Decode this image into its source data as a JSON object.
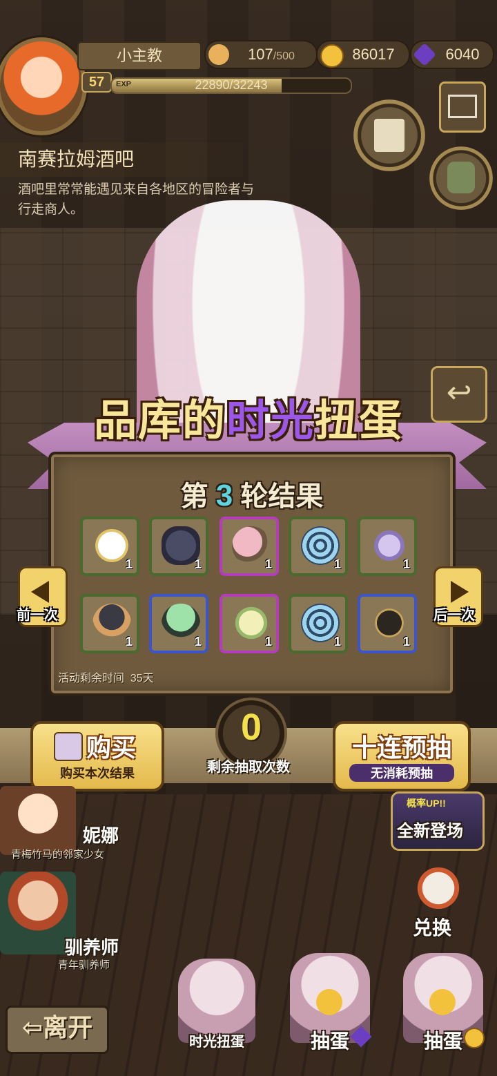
{
  "colors": {
    "panel_bg": "#6f5a3d",
    "title_gold": "#f8e79a",
    "title_purple": "#9b57e8",
    "round_number": "#5fd3e0",
    "count_yellow": "#f4e04a"
  },
  "player": {
    "name": "小主教",
    "level": "57",
    "exp_tag": "EXP",
    "exp_text": "22890/32243",
    "exp_fraction": 0.71
  },
  "resources": [
    {
      "icon": "bread-icon",
      "value": "107",
      "max": "/500"
    },
    {
      "icon": "gold-coin-icon",
      "value": "86017"
    },
    {
      "icon": "purple-gem-icon",
      "value": "6040"
    }
  ],
  "location": {
    "name": "南赛拉姆酒吧",
    "description": "酒吧里常常能遇见来自各地区的冒险者与行走商人。"
  },
  "banner": {
    "title_prefix": "品库的",
    "title_highlight": "时光",
    "title_suffix": "扭蛋"
  },
  "result": {
    "prefix": "第",
    "round": "3",
    "suffix": "轮结果",
    "timer_label": "活动剩余时间",
    "timer_value": "35天",
    "items": [
      {
        "name": "cloud-planet-icon",
        "qty": "1",
        "rarity": "green"
      },
      {
        "name": "dark-shell-icon",
        "qty": "1",
        "rarity": "green"
      },
      {
        "name": "pink-creature-icon",
        "qty": "1",
        "rarity": "purple"
      },
      {
        "name": "blue-spiral-shell-icon",
        "qty": "1",
        "rarity": "green"
      },
      {
        "name": "purple-seashell-icon",
        "qty": "1",
        "rarity": "green"
      },
      {
        "name": "dark-egg-icon",
        "qty": "1",
        "rarity": "green"
      },
      {
        "name": "green-slime-icon",
        "qty": "1",
        "rarity": "blue"
      },
      {
        "name": "leaf-snail-icon",
        "qty": "1",
        "rarity": "purple"
      },
      {
        "name": "blue-spiral-shell-icon",
        "qty": "1",
        "rarity": "green"
      },
      {
        "name": "dark-moth-icon",
        "qty": "1",
        "rarity": "blue"
      }
    ]
  },
  "nav": {
    "prev": "前一次",
    "next": "后一次"
  },
  "actions": {
    "buy_main": "购买",
    "buy_sub": "购买本次结果",
    "ten_main": "十连预抽",
    "ten_sub": "无消耗预抽",
    "remaining_count": "0",
    "remaining_label": "剩余抽取次数"
  },
  "npcs": [
    {
      "name": "妮娜",
      "subtitle": "青梅竹马的邻家少女"
    },
    {
      "name": "驯养师",
      "subtitle": "青年驯养师"
    }
  ],
  "side_buttons": {
    "new_arrival_badge": "概率UP!!",
    "new_arrival": "全新登场",
    "exchange": "兑换"
  },
  "bottom": {
    "leave": "离开",
    "machines": [
      "时光扭蛋",
      "抽蛋",
      "抽蛋"
    ]
  }
}
